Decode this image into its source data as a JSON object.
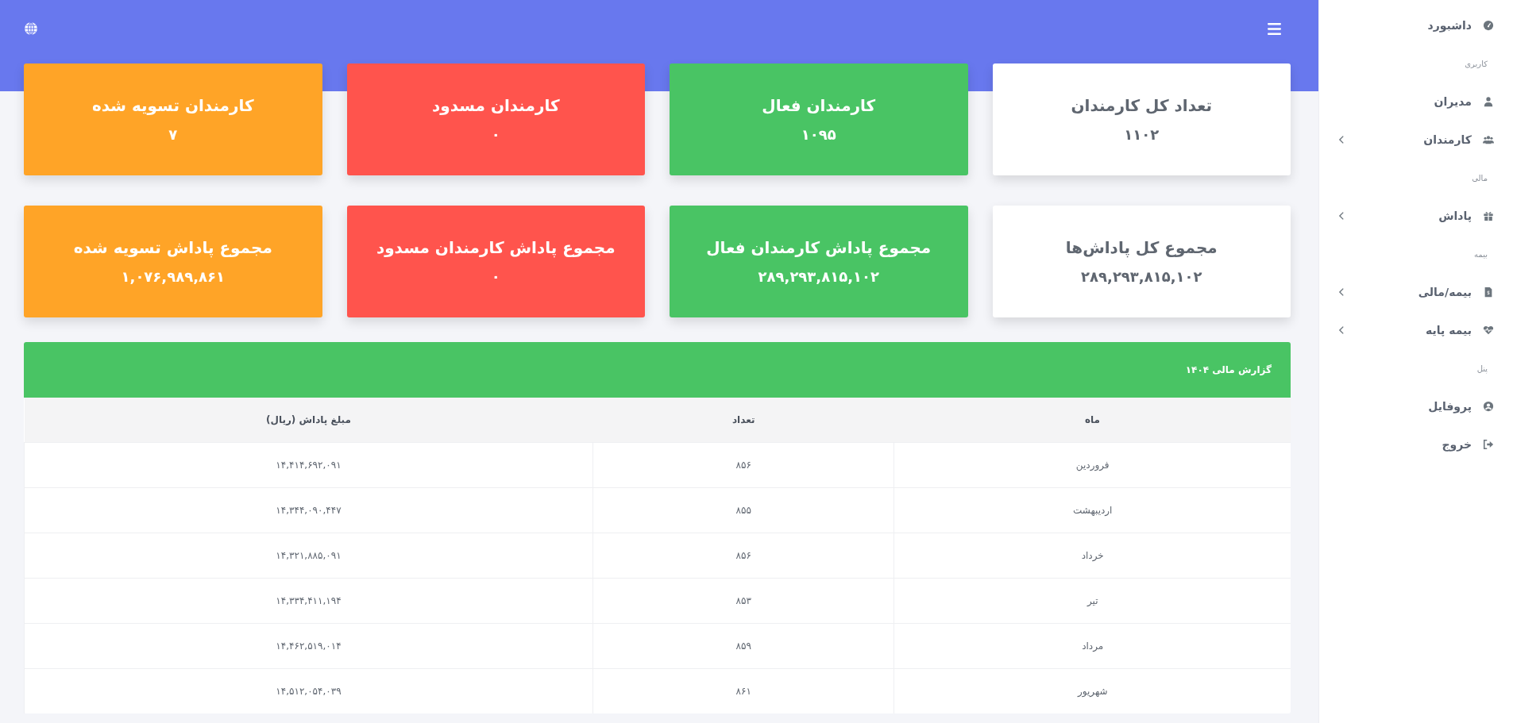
{
  "sidebar": {
    "items": [
      {
        "kind": "link",
        "label": "داشبورد",
        "has_submenu": false
      },
      {
        "kind": "section",
        "label": "کاربری"
      },
      {
        "kind": "link",
        "label": "مدیران",
        "has_submenu": false
      },
      {
        "kind": "link",
        "label": "کارمندان",
        "has_submenu": true
      },
      {
        "kind": "section",
        "label": "مالی"
      },
      {
        "kind": "link",
        "label": "پاداش",
        "has_submenu": true
      },
      {
        "kind": "section",
        "label": "بیمه"
      },
      {
        "kind": "link",
        "label": "بیمه/مالی",
        "has_submenu": true
      },
      {
        "kind": "link",
        "label": "بیمه پایه",
        "has_submenu": true
      },
      {
        "kind": "section",
        "label": "پنل"
      },
      {
        "kind": "link",
        "label": "پروفایل",
        "has_submenu": false
      },
      {
        "kind": "link",
        "label": "خروج",
        "has_submenu": false
      }
    ]
  },
  "stat_cards": [
    {
      "kind": "light",
      "title": "تعداد کل کارمندان",
      "value": "۱۱۰۲"
    },
    {
      "kind": "success",
      "title": "کارمندان فعال",
      "value": "۱۰۹۵"
    },
    {
      "kind": "danger",
      "title": "کارمندان مسدود",
      "value": "۰"
    },
    {
      "kind": "warning",
      "title": "کارمندان تسویه شده",
      "value": "۷"
    },
    {
      "kind": "light",
      "title": "مجموع کل پاداش‌ها",
      "value": "۲۸۹,۲۹۳,۸۱۵,۱۰۲"
    },
    {
      "kind": "success",
      "title": "مجموع پاداش کارمندان فعال",
      "value": "۲۸۹,۲۹۳,۸۱۵,۱۰۲"
    },
    {
      "kind": "danger",
      "title": "مجموع پاداش کارمندان مسدود",
      "value": "۰"
    },
    {
      "kind": "warning",
      "title": "مجموع پاداش تسویه شده",
      "value": "۱,۰۷۶,۹۸۹,۸۶۱"
    }
  ],
  "report": {
    "title": "گزارش مالی ۱۴۰۴",
    "columns": [
      "ماه",
      "تعداد",
      "مبلغ پاداش (ریال)"
    ],
    "rows": [
      [
        "فروردین",
        "۸۵۶",
        "۱۴,۴۱۴,۶۹۲,۰۹۱"
      ],
      [
        "اردیبهشت",
        "۸۵۵",
        "۱۴,۳۴۴,۰۹۰,۴۴۷"
      ],
      [
        "خرداد",
        "۸۵۶",
        "۱۴,۳۲۱,۸۸۵,۰۹۱"
      ],
      [
        "تیر",
        "۸۵۳",
        "۱۴,۳۳۴,۴۱۱,۱۹۴"
      ],
      [
        "مرداد",
        "۸۵۹",
        "۱۴,۴۶۲,۵۱۹,۰۱۴"
      ],
      [
        "شهریور",
        "۸۶۱",
        "۱۴,۵۱۲,۰۵۴,۰۳۹"
      ]
    ]
  }
}
